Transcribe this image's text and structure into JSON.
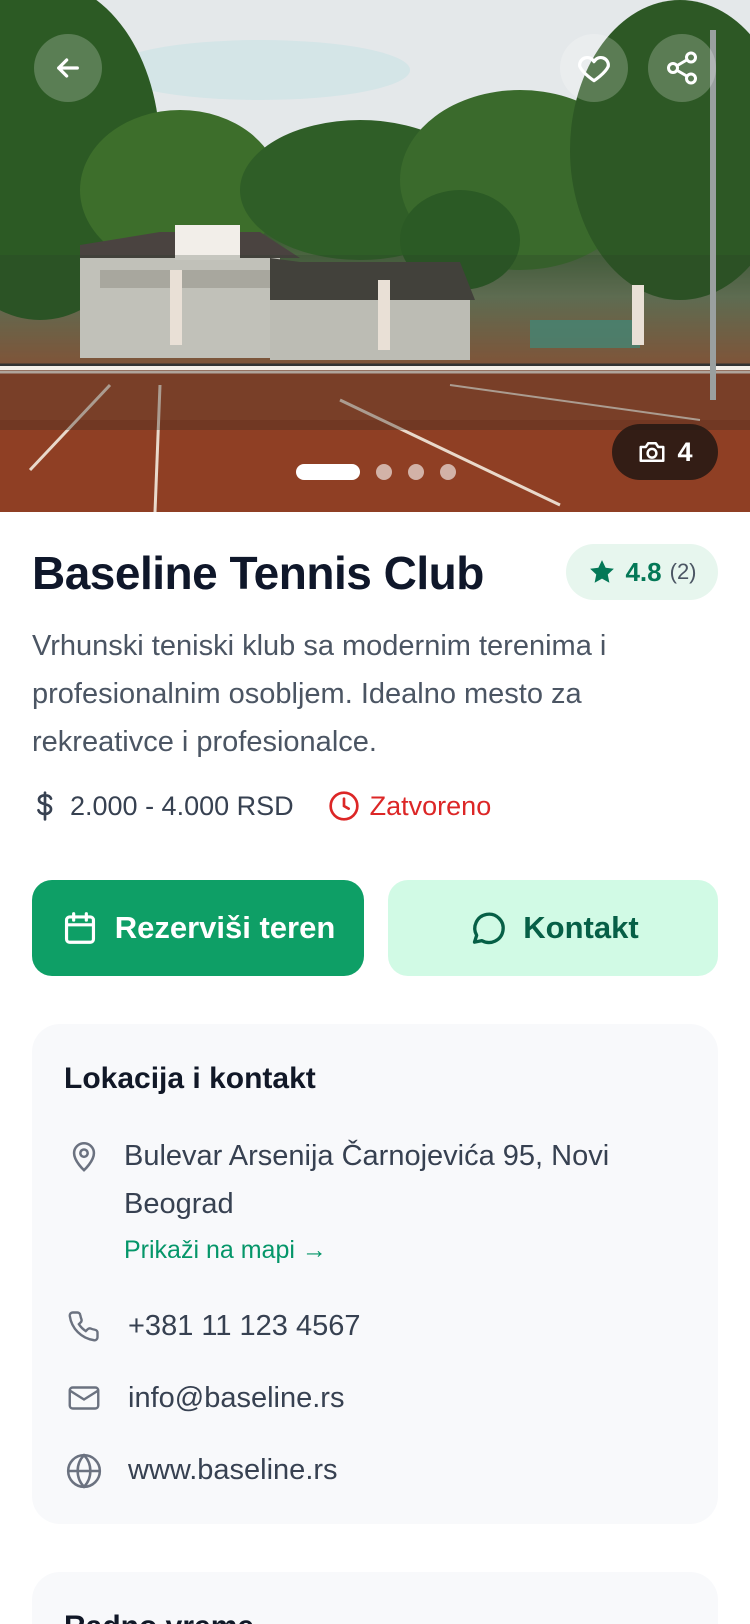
{
  "hero": {
    "photo_count": "4",
    "slides": 4,
    "active_slide": 1
  },
  "club": {
    "name": "Baseline Tennis Club",
    "rating": "4.8",
    "rating_count": "(2)",
    "description": "Vrhunski teniski klub sa modernim terenima i profesionalnim osobljem. Idealno mesto za rekreativce i profesionalce.",
    "price": "2.000 - 4.000 RSD",
    "status": "Zatvoreno"
  },
  "actions": {
    "book_label": "Rezerviši teren",
    "contact_label": "Kontakt"
  },
  "location": {
    "title": "Lokacija i kontakt",
    "address": "Bulevar Arsenija Čarnojevića 95, Novi Beograd",
    "map_link": "Prikaži na mapi →",
    "phone": "+381 11 123 4567",
    "email": "info@baseline.rs",
    "website": "www.baseline.rs"
  },
  "hours": {
    "title": "Radno vreme"
  },
  "colors": {
    "primary": "#0e9f66",
    "primary_light": "#d1fae5",
    "closed": "#dc2626",
    "star": "#047857"
  }
}
